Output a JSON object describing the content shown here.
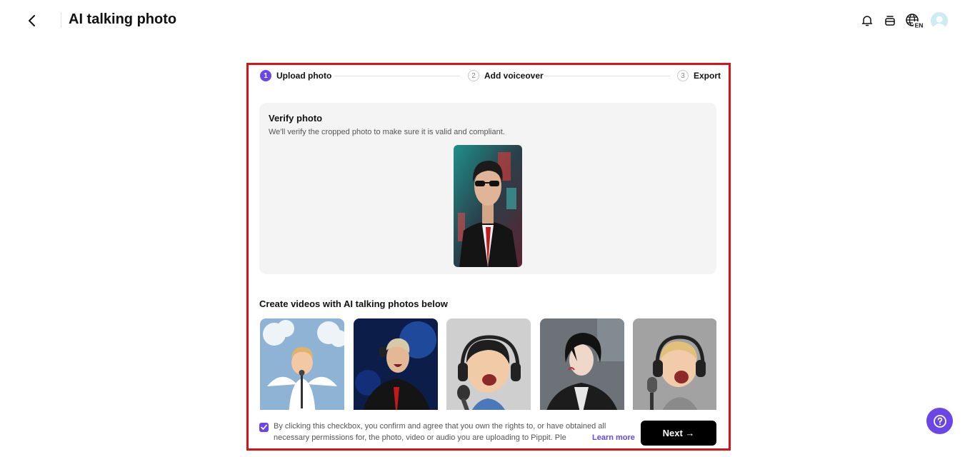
{
  "header": {
    "title": "AI talking photo",
    "back_icon": "back-arrow-icon",
    "icons": [
      "bell-icon",
      "subscription-icon",
      "language-icon",
      "avatar"
    ],
    "language_badge": "EN"
  },
  "stepper": {
    "steps": [
      {
        "num": "1",
        "label": "Upload photo",
        "active": true
      },
      {
        "num": "2",
        "label": "Add voiceover",
        "active": false
      },
      {
        "num": "3",
        "label": "Export",
        "active": false
      }
    ]
  },
  "verify": {
    "title": "Verify photo",
    "description": "We'll verify the cropped photo to make sure it is valid and compliant."
  },
  "examples": {
    "title": "Create videos with AI talking photos below",
    "items": [
      "angel baby singing",
      "singer on stage",
      "baby with headphones",
      "anime character",
      "baby with microphone"
    ]
  },
  "footer": {
    "consent_checked": true,
    "consent_text": "By clicking this checkbox, you confirm and agree that you own the rights to, or have obtained all necessary permissions for, the photo, video or audio you are uploading to Pippit. Ple",
    "learn_more": "Learn more",
    "next_label": "Next →"
  },
  "colors": {
    "accent": "#6a45e8",
    "highlight_border": "#d8141b",
    "next_bg": "#000000"
  }
}
